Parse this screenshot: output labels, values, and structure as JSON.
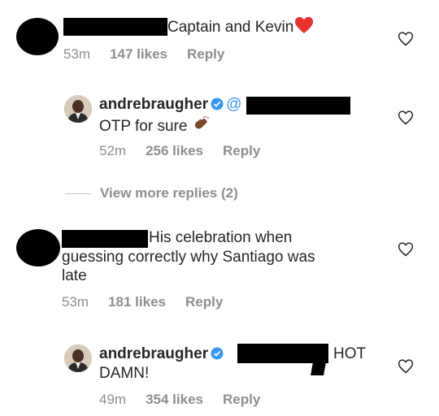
{
  "comments": [
    {
      "text": "Captain and Kevin",
      "time": "53m",
      "likes": "147 likes",
      "reply": "Reply",
      "emoji": "red-heart-emoji"
    },
    {
      "username": "andrebraugher",
      "mention_prefix": "@",
      "text": "OTP for sure",
      "time": "52m",
      "likes": "256 likes",
      "reply": "Reply",
      "emoji": "clapping-hands-emoji"
    },
    {
      "text_line1": "His celebration when",
      "text_line2": "guessing correctly why Santiago was",
      "text_line3": "late",
      "time": "53m",
      "likes": "181 likes",
      "reply": "Reply"
    },
    {
      "username": "andrebraugher",
      "text_line1": "HOT",
      "text_line2": "DAMN!",
      "time": "49m",
      "likes": "354 likes",
      "reply": "Reply"
    }
  ],
  "view_more": "View more replies (2)",
  "colors": {
    "text": "#262626",
    "meta": "#8e8e8e",
    "verified": "#3897f0",
    "heart": "#262626"
  }
}
